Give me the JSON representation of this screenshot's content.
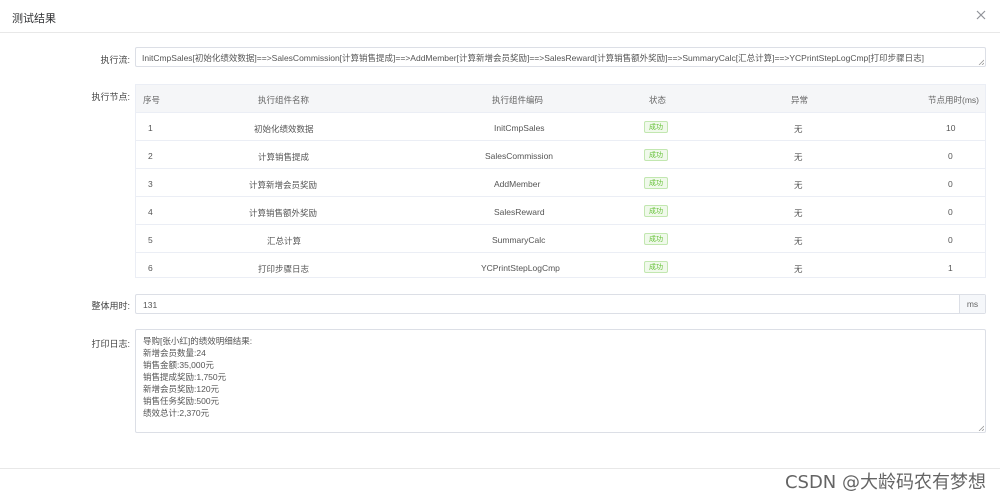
{
  "dialog": {
    "title": "测试结果"
  },
  "labels": {
    "flow": "执行流:",
    "nodes": "执行节点:",
    "total": "整体用时:",
    "log": "打印日志:"
  },
  "flow": {
    "value": "InitCmpSales[初始化绩效数据]==>SalesCommission[计算销售提成]==>AddMember[计算新增会员奖励]==>SalesReward[计算销售额外奖励]==>SummaryCalc[汇总计算]==>YCPrintStepLogCmp[打印步骤日志]"
  },
  "table": {
    "headers": [
      "序号",
      "执行组件名称",
      "执行组件编码",
      "状态",
      "异常",
      "节点用时(ms)"
    ],
    "rows": [
      {
        "no": "1",
        "name": "初始化绩效数据",
        "code": "InitCmpSales",
        "status": "成功",
        "error": "无",
        "time": "10"
      },
      {
        "no": "2",
        "name": "计算销售提成",
        "code": "SalesCommission",
        "status": "成功",
        "error": "无",
        "time": "0"
      },
      {
        "no": "3",
        "name": "计算新增会员奖励",
        "code": "AddMember",
        "status": "成功",
        "error": "无",
        "time": "0"
      },
      {
        "no": "4",
        "name": "计算销售额外奖励",
        "code": "SalesReward",
        "status": "成功",
        "error": "无",
        "time": "0"
      },
      {
        "no": "5",
        "name": "汇总计算",
        "code": "SummaryCalc",
        "status": "成功",
        "error": "无",
        "time": "0"
      },
      {
        "no": "6",
        "name": "打印步骤日志",
        "code": "YCPrintStepLogCmp",
        "status": "成功",
        "error": "无",
        "time": "1"
      }
    ]
  },
  "total": {
    "value": "131",
    "unit": "ms"
  },
  "log": {
    "lines": [
      "导购[张小红]的绩效明细结果:",
      "新增会员数量:24",
      "销售金额:35,000元",
      "销售提成奖励:1,750元",
      "新增会员奖励:120元",
      "销售任务奖励:500元",
      "绩效总计:2,370元"
    ]
  },
  "watermark": "CSDN @大龄码农有梦想",
  "colors": {
    "success_text": "#67c23a",
    "success_bg": "#f0f9eb",
    "border": "#dcdfe6",
    "header_bg": "#f5f6f8"
  }
}
